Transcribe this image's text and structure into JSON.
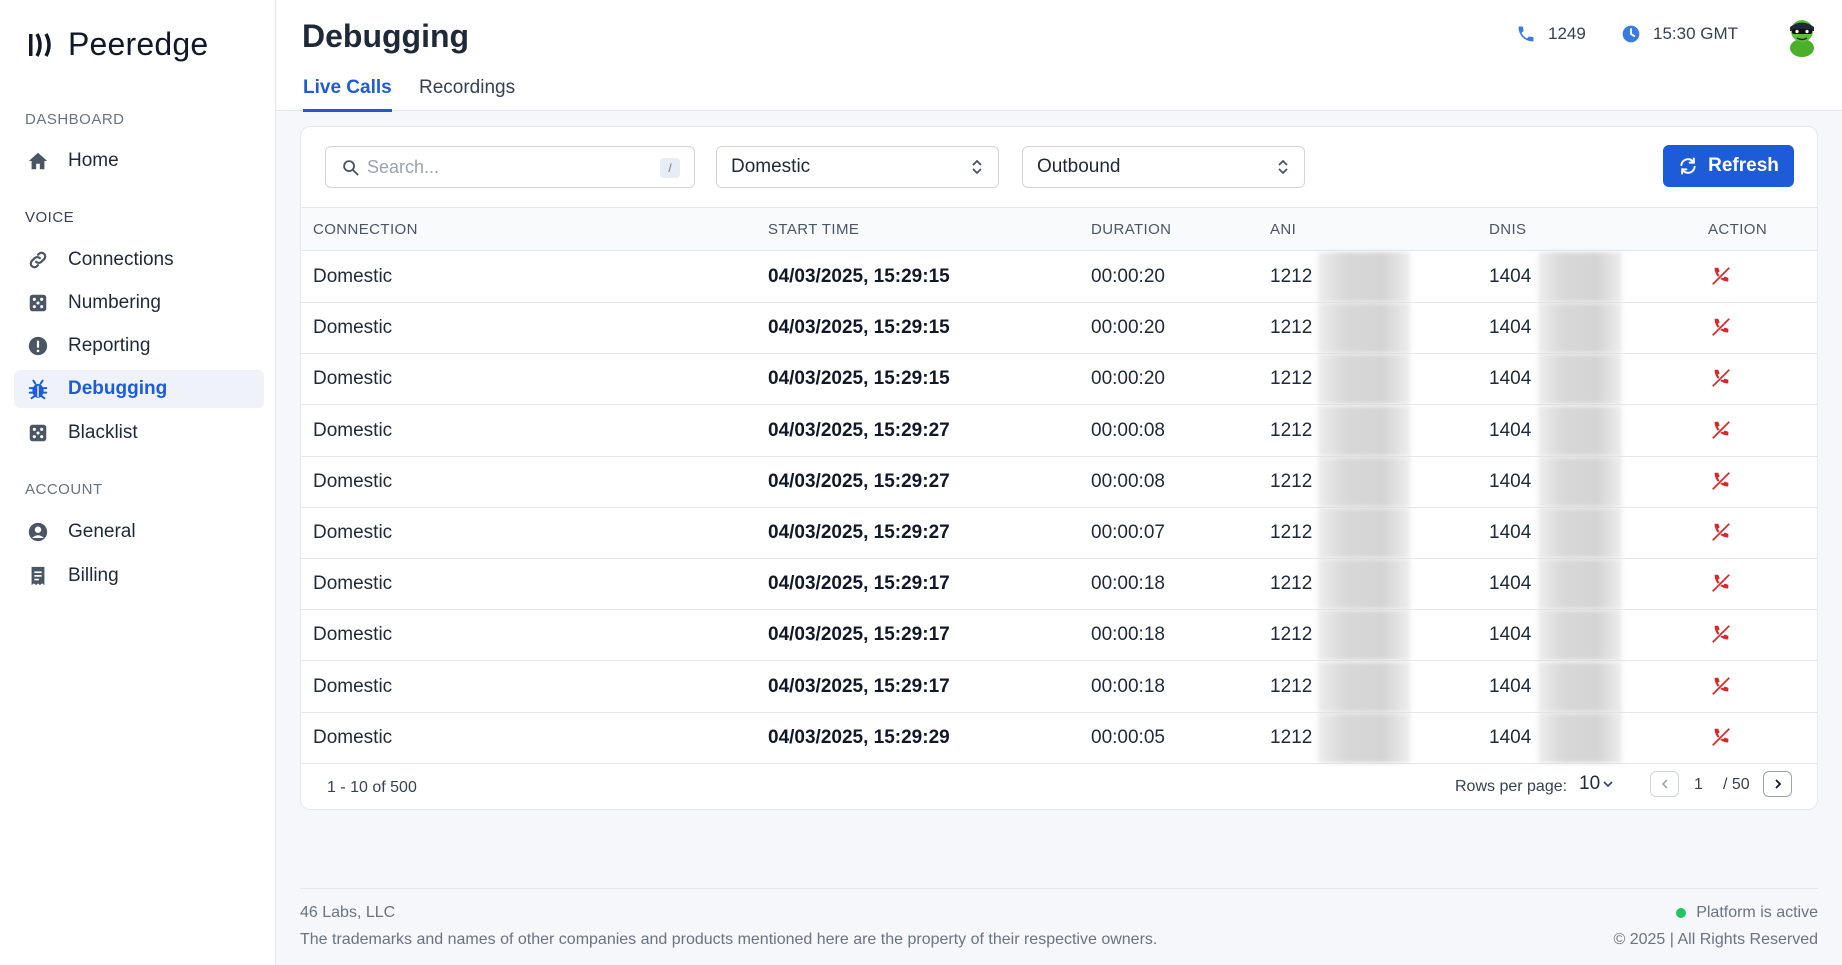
{
  "brand": {
    "name": "Peeredge"
  },
  "sidebar": {
    "sections": [
      {
        "label": "DASHBOARD"
      },
      {
        "label": "VOICE"
      },
      {
        "label": "ACCOUNT"
      }
    ],
    "items": [
      {
        "label": "Home",
        "icon": "home-icon"
      },
      {
        "label": "Connections",
        "icon": "link-icon"
      },
      {
        "label": "Numbering",
        "icon": "dice-icon"
      },
      {
        "label": "Reporting",
        "icon": "alert-icon"
      },
      {
        "label": "Debugging",
        "icon": "bug-icon",
        "active": true
      },
      {
        "label": "Blacklist",
        "icon": "dice-icon"
      },
      {
        "label": "General",
        "icon": "user-circle-icon"
      },
      {
        "label": "Billing",
        "icon": "receipt-icon"
      }
    ]
  },
  "header": {
    "title": "Debugging",
    "tabs": [
      {
        "label": "Live Calls",
        "active": true
      },
      {
        "label": "Recordings",
        "active": false
      }
    ],
    "calls_count": "1249",
    "time": "15:30 GMT"
  },
  "filters": {
    "search_placeholder": "Search...",
    "search_shortcut": "/",
    "connection_type": "Domestic",
    "direction": "Outbound",
    "refresh_label": "Refresh"
  },
  "table": {
    "columns": [
      "CONNECTION",
      "START TIME",
      "DURATION",
      "ANI",
      "DNIS",
      "ACTION"
    ],
    "rows": [
      {
        "connection": "Domestic",
        "start_time": "04/03/2025, 15:29:15",
        "duration": "00:00:20",
        "ani": "1212",
        "dnis": "1404"
      },
      {
        "connection": "Domestic",
        "start_time": "04/03/2025, 15:29:15",
        "duration": "00:00:20",
        "ani": "1212",
        "dnis": "1404"
      },
      {
        "connection": "Domestic",
        "start_time": "04/03/2025, 15:29:15",
        "duration": "00:00:20",
        "ani": "1212",
        "dnis": "1404"
      },
      {
        "connection": "Domestic",
        "start_time": "04/03/2025, 15:29:27",
        "duration": "00:00:08",
        "ani": "1212",
        "dnis": "1404"
      },
      {
        "connection": "Domestic",
        "start_time": "04/03/2025, 15:29:27",
        "duration": "00:00:08",
        "ani": "1212",
        "dnis": "1404"
      },
      {
        "connection": "Domestic",
        "start_time": "04/03/2025, 15:29:27",
        "duration": "00:00:07",
        "ani": "1212",
        "dnis": "1404"
      },
      {
        "connection": "Domestic",
        "start_time": "04/03/2025, 15:29:17",
        "duration": "00:00:18",
        "ani": "1212",
        "dnis": "1404"
      },
      {
        "connection": "Domestic",
        "start_time": "04/03/2025, 15:29:17",
        "duration": "00:00:18",
        "ani": "1212",
        "dnis": "1404"
      },
      {
        "connection": "Domestic",
        "start_time": "04/03/2025, 15:29:17",
        "duration": "00:00:18",
        "ani": "1212",
        "dnis": "1404"
      },
      {
        "connection": "Domestic",
        "start_time": "04/03/2025, 15:29:29",
        "duration": "00:00:05",
        "ani": "1212",
        "dnis": "1404"
      }
    ]
  },
  "pagination": {
    "summary": "1 - 10 of 500",
    "rows_per_page_label": "Rows per page:",
    "rows_per_page": "10",
    "current_page": "1",
    "total_pages": "/ 50"
  },
  "footer": {
    "company": "46 Labs, LLC",
    "disclaimer": "The trademarks and names of other companies and products mentioned here are the property of their respective owners.",
    "status": "Platform is active",
    "copyright": "© 2025 | All Rights Reserved"
  },
  "colors": {
    "accent": "#1d5bd8",
    "danger": "#dc2626",
    "status_ok": "#22c55e"
  }
}
